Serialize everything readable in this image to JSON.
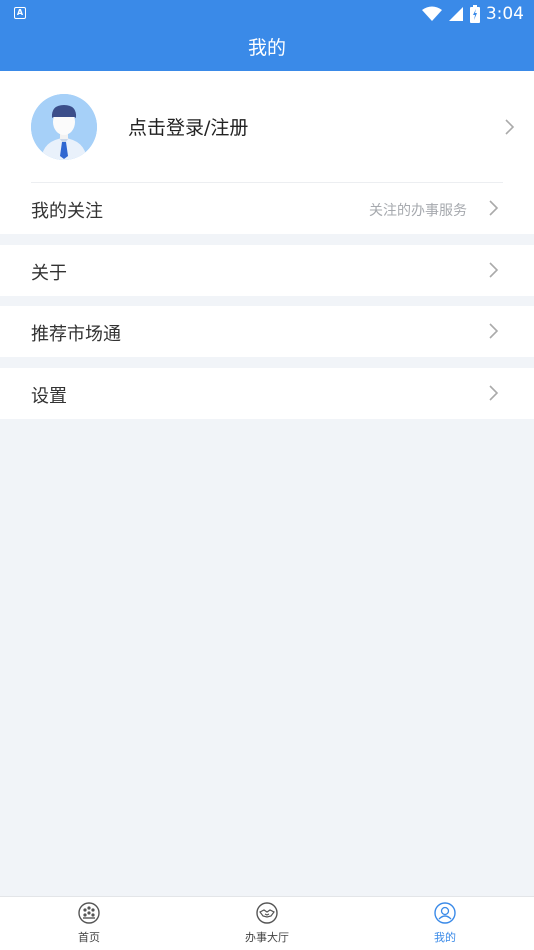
{
  "status_bar": {
    "time": "3:04",
    "app_indicator": "A"
  },
  "header": {
    "title": "我的"
  },
  "profile": {
    "login_text": "点击登录/注册",
    "avatar_icon": "user-avatar-icon"
  },
  "menu": {
    "follow": {
      "label": "我的关注",
      "sub": "关注的办事服务"
    },
    "about": {
      "label": "关于"
    },
    "recommend": {
      "label": "推荐市场通"
    },
    "settings": {
      "label": "设置"
    }
  },
  "tabs": [
    {
      "label": "首页",
      "icon": "home-icon"
    },
    {
      "label": "办事大厅",
      "icon": "handshake-icon"
    },
    {
      "label": "我的",
      "icon": "person-icon"
    }
  ],
  "colors": {
    "primary": "#3a8ae8",
    "background": "#f1f4f8",
    "subtext": "#a6a9ae"
  }
}
